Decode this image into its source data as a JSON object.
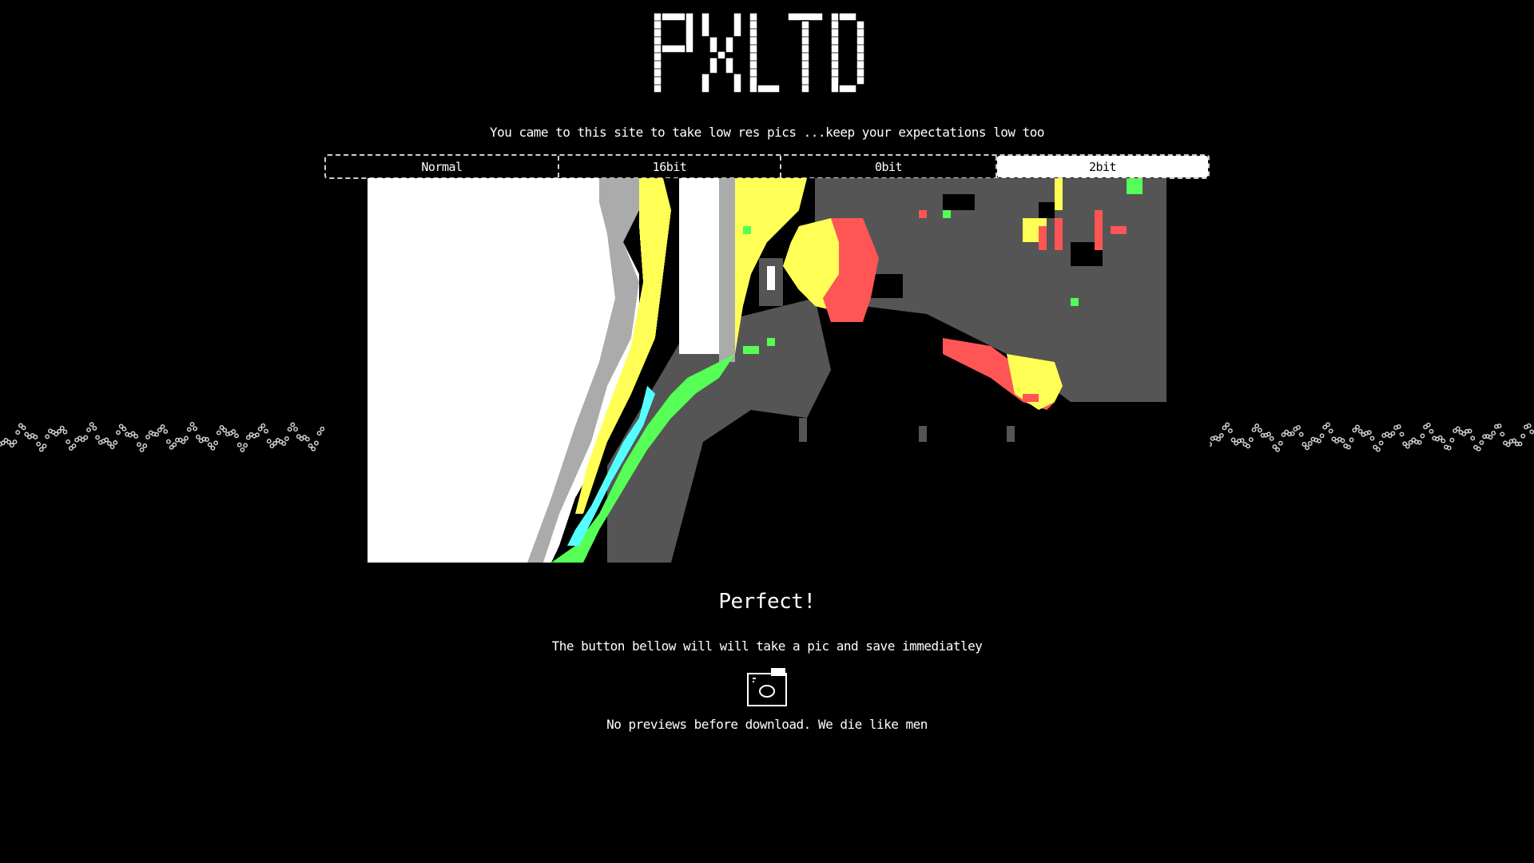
{
  "logo": {
    "text": "PXLTD"
  },
  "tagline": "You came to this site to take low res pics ...keep your expectations low too",
  "tabs": [
    {
      "label": "Normal",
      "active": false
    },
    {
      "label": "16bit",
      "active": false
    },
    {
      "label": "0bit",
      "active": false
    },
    {
      "label": "2bit",
      "active": true
    }
  ],
  "preview": {
    "palette": [
      "#ffffff",
      "#ababab",
      "#555555",
      "#ffff55",
      "#ff5555",
      "#55ff55",
      "#55ffff",
      "#000000"
    ]
  },
  "status": "Perfect!",
  "instructions": "The button bellow will will take a pic and save immediatley",
  "camera_button": {
    "icon": "camera-icon"
  },
  "footnote": "No previews before download. We die like men"
}
